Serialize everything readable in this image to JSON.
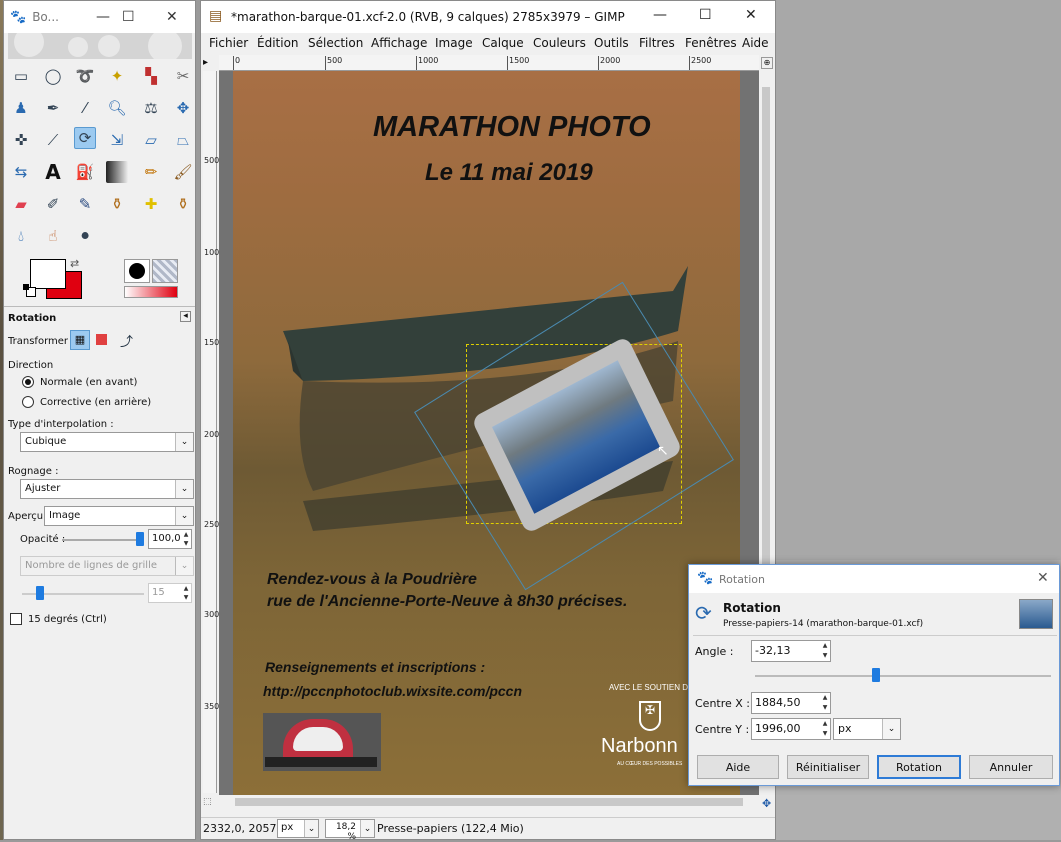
{
  "toolbox": {
    "title": "Bo...",
    "tool_options_title": "Rotation",
    "transform_label": "Transformer :",
    "direction_label": "Direction",
    "direction_normal": "Normale (en avant)",
    "direction_corrective": "Corrective (en arrière)",
    "interp_label": "Type d'interpolation :",
    "interp_value": "Cubique",
    "clipping_label": "Rognage :",
    "clipping_value": "Ajuster",
    "preview_label": "Aperçu :",
    "preview_value": "Image",
    "opacity_label": "Opacité :",
    "opacity_value": "100,0",
    "opacity_fraction": 1.0,
    "guides_value": "Nombre de lignes de grille",
    "guides_count": "15",
    "snap_label": "15 degrés (Ctrl)",
    "fg_color": "#ffffff",
    "bg_color": "#e00010"
  },
  "gimp": {
    "title": "*marathon-barque-01.xcf-2.0 (RVB, 9 calques) 2785x3979 – GIMP",
    "menu": [
      "Fichier",
      "Édition",
      "Sélection",
      "Affichage",
      "Image",
      "Calque",
      "Couleurs",
      "Outils",
      "Filtres",
      "Fenêtres",
      "Aide"
    ],
    "ruler_h": [
      "0",
      "500",
      "1000",
      "1500",
      "2000",
      "2500"
    ],
    "ruler_v": [
      "500",
      "1000",
      "1500",
      "2000",
      "2500",
      "3000",
      "3500"
    ],
    "status_coords": "2332,0, 2057,0",
    "status_unit": "px",
    "status_zoom": "18,2 %",
    "status_message": "Presse-papiers (122,4 Mio)"
  },
  "poster": {
    "title": "MARATHON PHOTO",
    "date": "Le 11 mai 2019",
    "rdv_line1": "Rendez-vous à la Poudrière",
    "rdv_line2": "rue de l'Ancienne-Porte-Neuve à 8h30 précises.",
    "info_line1": "Renseignements et inscriptions :",
    "info_line2": "http://pccnphotoclub.wixsite.com/pccn",
    "support": "AVEC LE SOUTIEN D",
    "city": "Narbonn",
    "city_tagline": "AU CŒUR DES POSSIBLES"
  },
  "rotation_dialog": {
    "title": "Rotation",
    "heading": "Rotation",
    "subheading": "Presse-papiers-14 (marathon-barque-01.xcf)",
    "angle_label": "Angle :",
    "angle_value": "-32,13",
    "angle_fraction": 0.41,
    "center_x_label": "Centre X :",
    "center_x_value": "1884,50",
    "center_y_label": "Centre Y :",
    "center_y_value": "1996,00",
    "unit": "px",
    "btn_help": "Aide",
    "btn_reset": "Réinitialiser",
    "btn_rotate": "Rotation",
    "btn_cancel": "Annuler"
  }
}
